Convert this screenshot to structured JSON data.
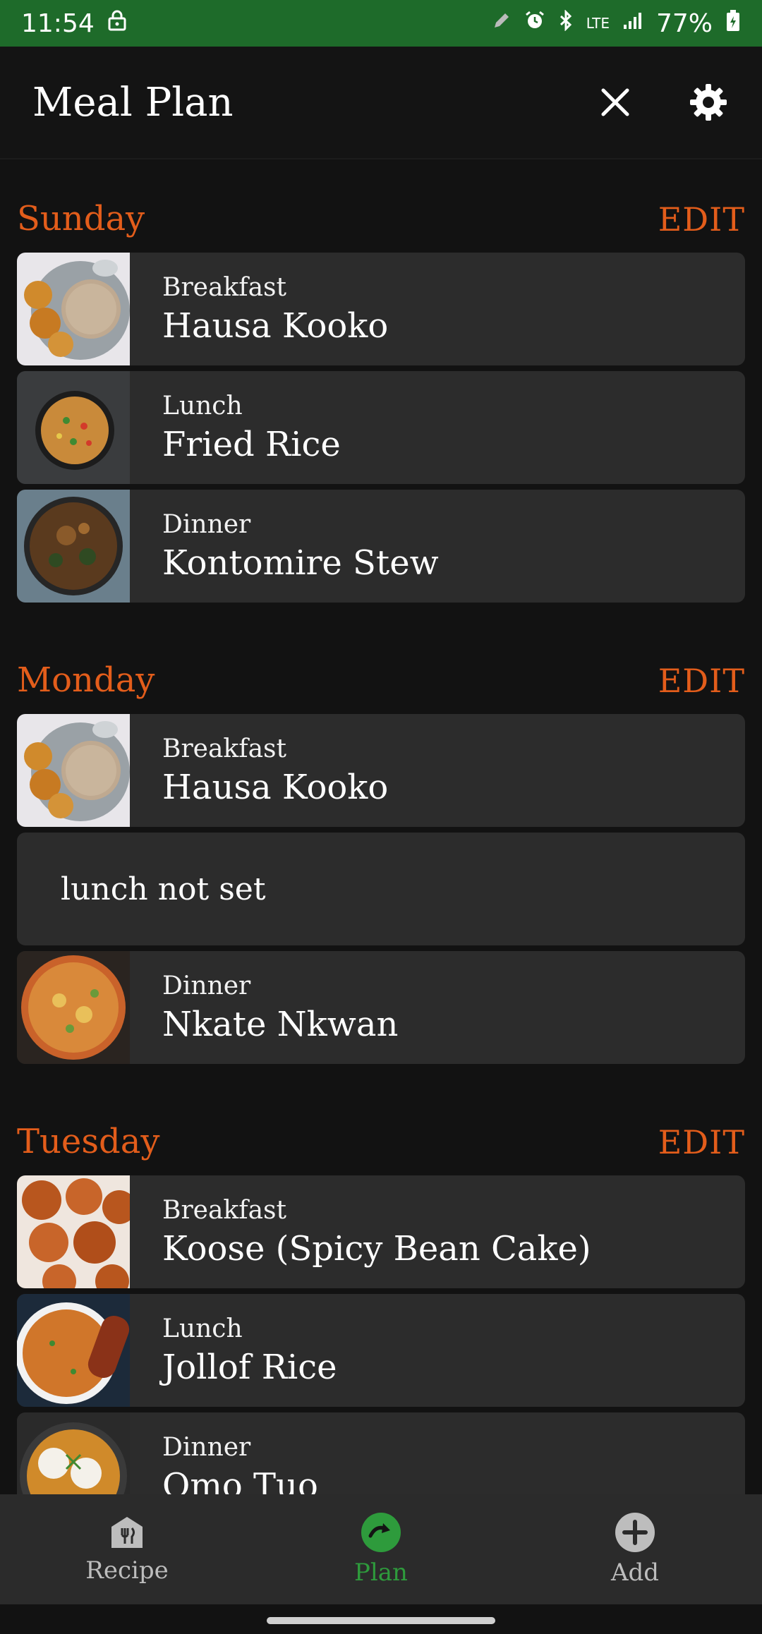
{
  "status_bar": {
    "time": "11:54",
    "network": "LTE",
    "battery": "77%"
  },
  "app_bar": {
    "title": "Meal Plan"
  },
  "days": [
    {
      "name": "Sunday",
      "edit_label": "EDIT",
      "meals": [
        {
          "type": "Breakfast",
          "name": "Hausa Kooko"
        },
        {
          "type": "Lunch",
          "name": "Fried Rice"
        },
        {
          "type": "Dinner",
          "name": "Kontomire Stew"
        }
      ]
    },
    {
      "name": "Monday",
      "edit_label": "EDIT",
      "meals": [
        {
          "type": "Breakfast",
          "name": "Hausa Kooko"
        },
        {
          "empty_label": "lunch not set"
        },
        {
          "type": "Dinner",
          "name": "Nkate Nkwan"
        }
      ]
    },
    {
      "name": "Tuesday",
      "edit_label": "EDIT",
      "meals": [
        {
          "type": "Breakfast",
          "name": "Koose (Spicy Bean Cake)"
        },
        {
          "type": "Lunch",
          "name": "Jollof Rice"
        },
        {
          "type": "Dinner",
          "name": "Omo Tuo"
        }
      ]
    }
  ],
  "bottom_nav": {
    "items": [
      {
        "label": "Recipe",
        "icon": "recipe-icon"
      },
      {
        "label": "Plan",
        "icon": "plan-icon"
      },
      {
        "label": "Add",
        "icon": "add-icon"
      }
    ]
  },
  "colors": {
    "accent": "#e35d1b",
    "status_bar": "#1e6b2a",
    "active_nav": "#2e9b3c",
    "card": "#2c2c2c",
    "background": "#121212"
  }
}
